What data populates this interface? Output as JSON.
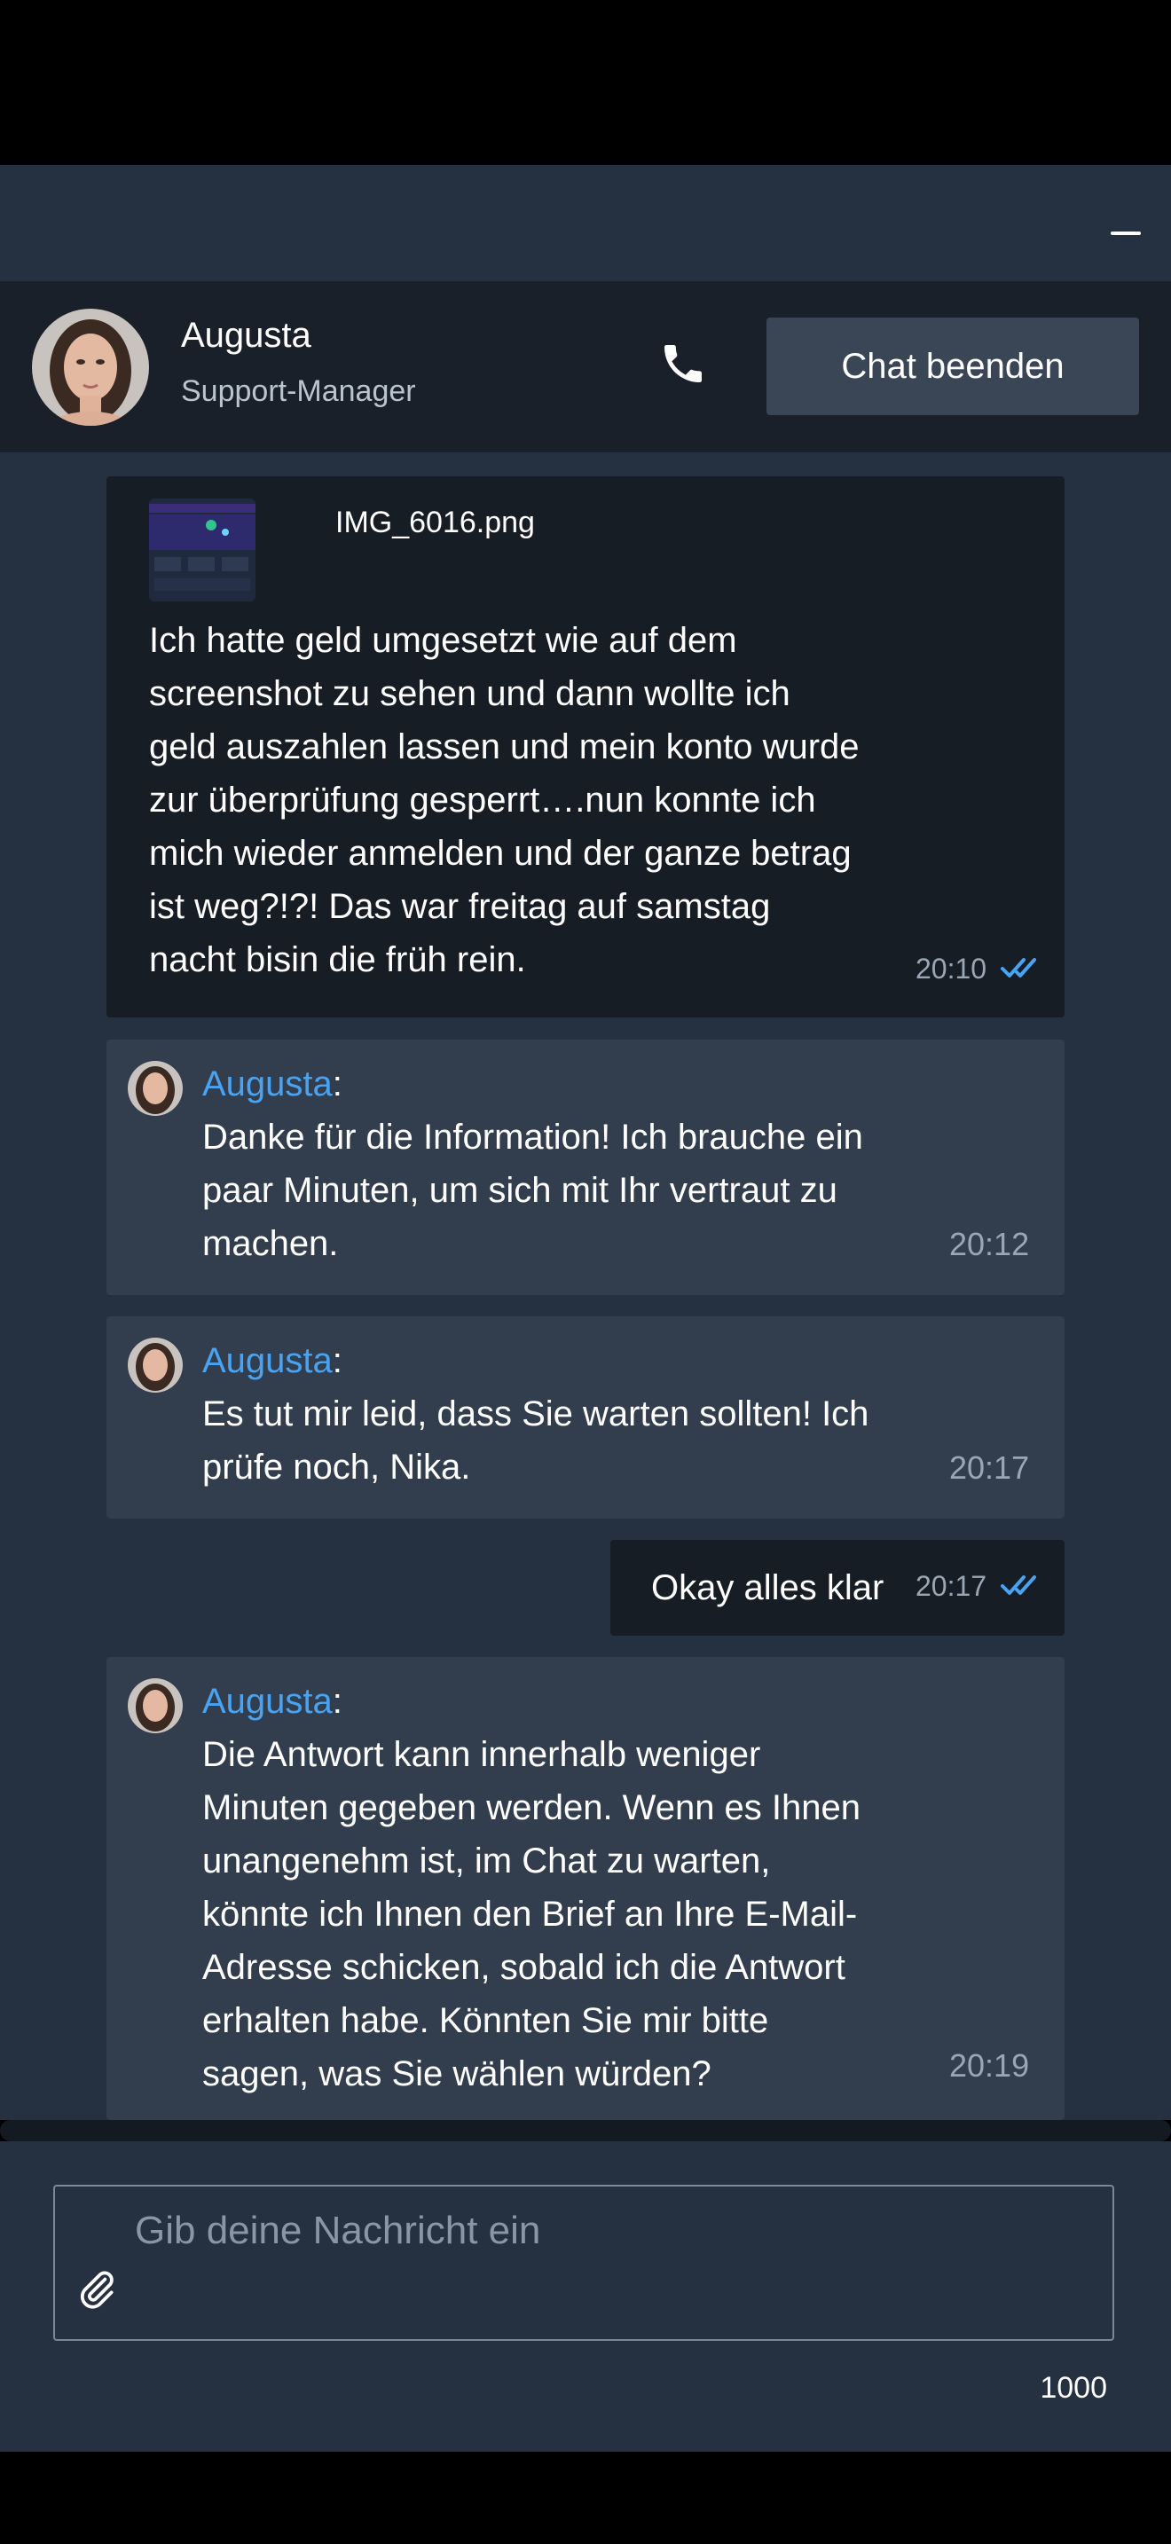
{
  "header": {
    "agent_name": "Augusta",
    "agent_role": "Support-Manager",
    "end_chat_label": "Chat beenden"
  },
  "messages": [
    {
      "from": "user",
      "attachment_name": "IMG_6016.png",
      "text": "Ich hatte geld umgesetzt wie auf dem\nscreenshot zu sehen und dann wollte ich\ngeld auszahlen lassen und mein konto wurde\nzur überprüfung gesperrt….nun konnte ich\nmich wieder anmelden und der ganze betrag\nist weg?!?! Das war freitag auf samstag\nnacht bisin die früh rein.",
      "time": "20:10"
    },
    {
      "from": "agent",
      "sender": "Augusta",
      "text": "Danke für die Information! Ich brauche ein\npaar Minuten, um sich mit Ihr vertraut zu\nmachen.",
      "time": "20:12"
    },
    {
      "from": "agent",
      "sender": "Augusta",
      "text": "Es tut mir leid, dass Sie warten sollten! Ich\nprüfe noch, Nika.",
      "time": "20:17"
    },
    {
      "from": "user",
      "text": "Okay alles klar",
      "time": "20:17"
    },
    {
      "from": "agent",
      "sender": "Augusta",
      "text": "Die Antwort kann innerhalb weniger\nMinuten gegeben werden. Wenn es Ihnen\nunangenehm ist, im Chat zu warten,\nkönnte ich Ihnen den Brief an Ihre E-Mail-\nAdresse schicken, sobald ich die Antwort\nerhalten habe. Könnten Sie mir bitte\nsagen, was Sie wählen würden?",
      "time": "20:19"
    }
  ],
  "composer": {
    "placeholder": "Gib deine Nachricht ein",
    "char_counter": "1000"
  },
  "colors": {
    "accent": "#4aa3f0",
    "panel": "#253040",
    "header": "#192029",
    "agent_bubble": "#323d4d",
    "user_bubble": "#171d25"
  }
}
